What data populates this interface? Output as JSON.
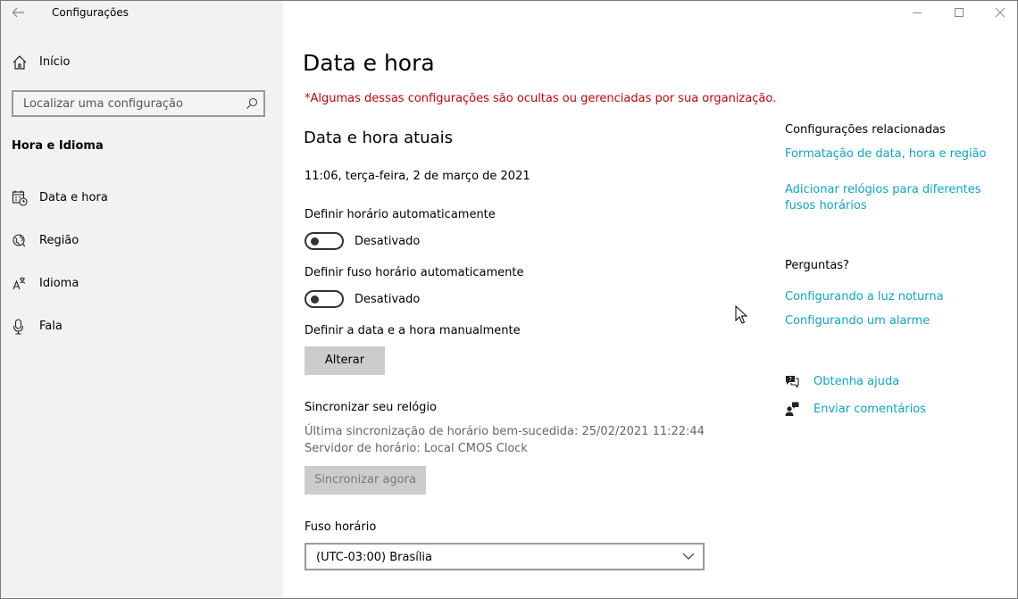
{
  "window": {
    "title": "Configurações",
    "controls": [
      "minimize-icon",
      "maximize-icon",
      "close-icon"
    ]
  },
  "sidebar": {
    "home_label": "Início",
    "search_placeholder": "Localizar uma configuração",
    "section_title": "Hora e Idioma",
    "items": [
      {
        "label": "Data e hora",
        "icon": "calendar-clock-icon"
      },
      {
        "label": "Região",
        "icon": "globe-icon"
      },
      {
        "label": "Idioma",
        "icon": "language-icon"
      },
      {
        "label": "Fala",
        "icon": "microphone-icon"
      }
    ]
  },
  "main": {
    "title": "Data e hora",
    "warning": "*Algumas dessas configurações são ocultas ou gerenciadas por sua organização.",
    "current_heading": "Data e hora atuais",
    "current_datetime": "11:06, terça-feira, 2 de março de 2021",
    "auto_time": {
      "label": "Definir horário automaticamente",
      "state": "Desativado"
    },
    "auto_timezone": {
      "label": "Definir fuso horário automaticamente",
      "state": "Desativado"
    },
    "manual": {
      "label": "Definir a data e a hora manualmente",
      "button": "Alterar"
    },
    "sync": {
      "heading": "Sincronizar seu relógio",
      "last_sync": "Última sincronização de horário bem-sucedida: 25/02/2021 11:22:44",
      "server": "Servidor de horário: Local CMOS Clock",
      "button": "Sincronizar agora"
    },
    "timezone": {
      "label": "Fuso horário",
      "value": "(UTC-03:00) Brasília"
    }
  },
  "related": {
    "heading": "Configurações relacionadas",
    "link1": "Formatação de data, hora e região",
    "link2": "Adicionar relógios para diferentes fusos horários",
    "questions_heading": "Perguntas?",
    "link3": "Configurando a luz noturna",
    "link4": "Configurando um alarme",
    "help": "Obtenha ajuda",
    "feedback": "Enviar comentários"
  },
  "colors": {
    "accent": "#0ea5c4",
    "warning": "#c50500",
    "sidebar_bg": "#f2f2f2"
  }
}
